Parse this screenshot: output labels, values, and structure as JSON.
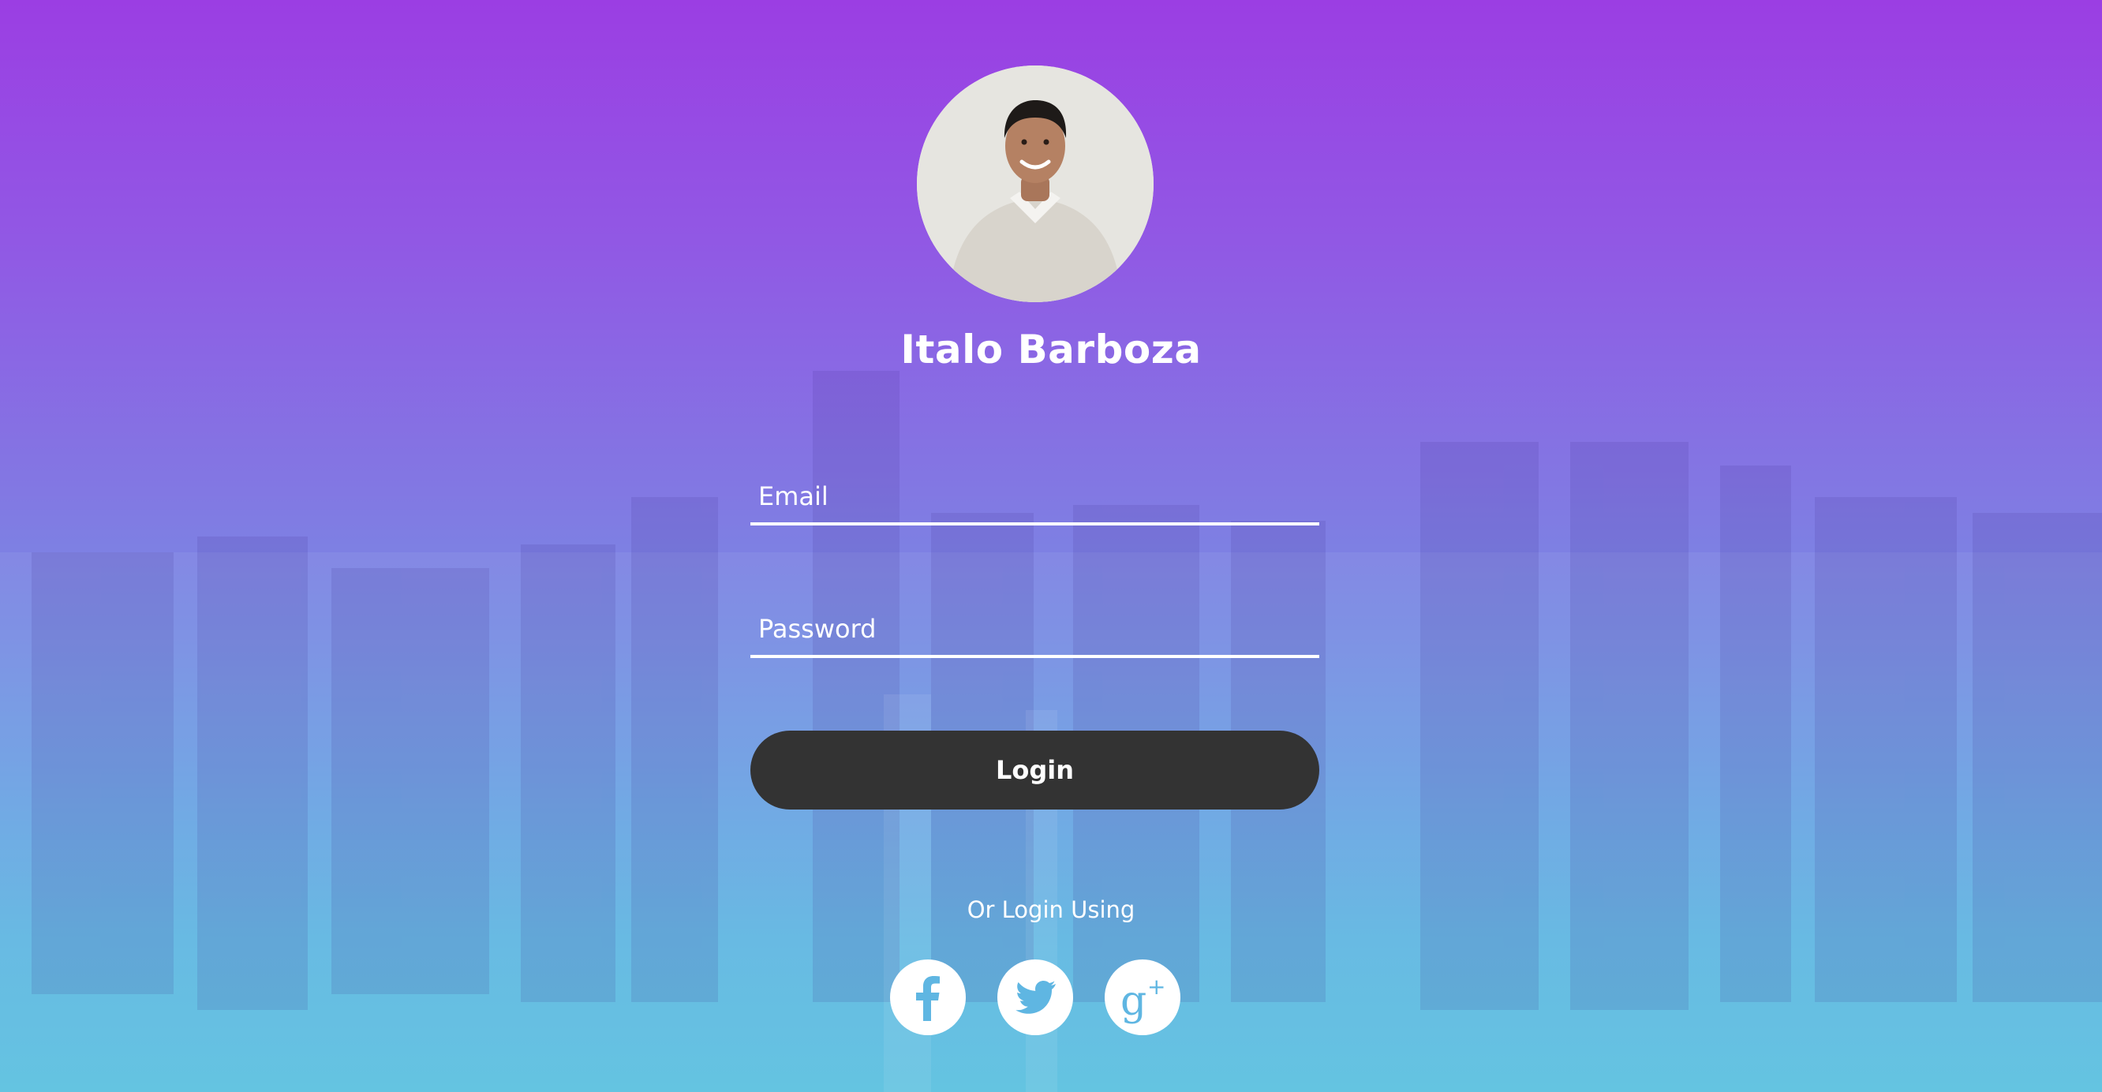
{
  "profile": {
    "name": "Italo Barboza",
    "avatar_icon": "user-photo"
  },
  "form": {
    "email_placeholder": "Email",
    "password_placeholder": "Password",
    "login_label": "Login"
  },
  "social": {
    "prompt": "Or Login Using",
    "providers": [
      {
        "name": "facebook",
        "icon": "facebook-icon"
      },
      {
        "name": "twitter",
        "icon": "twitter-icon"
      },
      {
        "name": "google-plus",
        "icon": "google-plus-icon"
      }
    ]
  },
  "colors": {
    "gradient_top": "#9b3ee3",
    "gradient_bottom": "#5bc1e0",
    "button": "#333333",
    "icon_fill": "#5fb6e2",
    "text": "#ffffff"
  }
}
